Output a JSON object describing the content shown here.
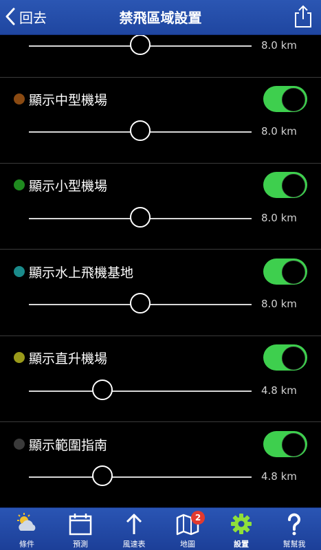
{
  "header": {
    "back_label": "回去",
    "title": "禁飛區域設置"
  },
  "top_slider": {
    "value_label": "8.0 km",
    "fraction": 0.5
  },
  "rows": [
    {
      "label": "顯示中型機場",
      "dot_color": "#8a4a12",
      "toggle_on": true,
      "value_label": "8.0 km",
      "fraction": 0.5
    },
    {
      "label": "顯示小型機場",
      "dot_color": "#1f8a1f",
      "toggle_on": true,
      "value_label": "8.0 km",
      "fraction": 0.5
    },
    {
      "label": "顯示水上飛機基地",
      "dot_color": "#1a8a8a",
      "toggle_on": true,
      "value_label": "8.0 km",
      "fraction": 0.5
    },
    {
      "label": "顯示直升機場",
      "dot_color": "#9a9a1a",
      "toggle_on": true,
      "value_label": "4.8 km",
      "fraction": 0.33
    },
    {
      "label": "顯示範圍指南",
      "dot_color": "#3a3a3a",
      "toggle_on": true,
      "value_label": "4.8 km",
      "fraction": 0.33
    }
  ],
  "tabs": [
    {
      "label": "條件",
      "icon": "weather-icon"
    },
    {
      "label": "預測",
      "icon": "calendar-icon"
    },
    {
      "label": "風速表",
      "icon": "arrow-up-icon"
    },
    {
      "label": "地圖",
      "icon": "map-icon",
      "badge": "2"
    },
    {
      "label": "設置",
      "icon": "gear-icon",
      "active": true
    },
    {
      "label": "幫幫我",
      "icon": "help-icon"
    }
  ],
  "colors": {
    "accent_blue": "#2350b0",
    "toggle_green": "#3ecf4e"
  }
}
